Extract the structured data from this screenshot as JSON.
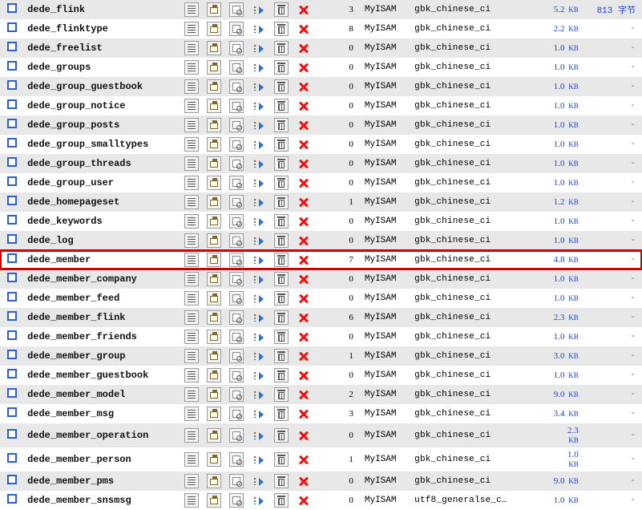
{
  "labels": {
    "size_unit": "KB",
    "overhead_unit": "字节",
    "dash": "-"
  },
  "tables": [
    {
      "name": "dede_flink",
      "rows": 3,
      "engine": "MyISAM",
      "collation": "gbk_chinese_ci",
      "size": "5.2",
      "overhead": "813"
    },
    {
      "name": "dede_flinktype",
      "rows": 8,
      "engine": "MyISAM",
      "collation": "gbk_chinese_ci",
      "size": "2.2",
      "overhead": null
    },
    {
      "name": "dede_freelist",
      "rows": 0,
      "engine": "MyISAM",
      "collation": "gbk_chinese_ci",
      "size": "1.0",
      "overhead": null
    },
    {
      "name": "dede_groups",
      "rows": 0,
      "engine": "MyISAM",
      "collation": "gbk_chinese_ci",
      "size": "1.0",
      "overhead": null
    },
    {
      "name": "dede_group_guestbook",
      "rows": 0,
      "engine": "MyISAM",
      "collation": "gbk_chinese_ci",
      "size": "1.0",
      "overhead": null
    },
    {
      "name": "dede_group_notice",
      "rows": 0,
      "engine": "MyISAM",
      "collation": "gbk_chinese_ci",
      "size": "1.0",
      "overhead": null
    },
    {
      "name": "dede_group_posts",
      "rows": 0,
      "engine": "MyISAM",
      "collation": "gbk_chinese_ci",
      "size": "1.0",
      "overhead": null
    },
    {
      "name": "dede_group_smalltypes",
      "rows": 0,
      "engine": "MyISAM",
      "collation": "gbk_chinese_ci",
      "size": "1.0",
      "overhead": null
    },
    {
      "name": "dede_group_threads",
      "rows": 0,
      "engine": "MyISAM",
      "collation": "gbk_chinese_ci",
      "size": "1.0",
      "overhead": null
    },
    {
      "name": "dede_group_user",
      "rows": 0,
      "engine": "MyISAM",
      "collation": "gbk_chinese_ci",
      "size": "1.0",
      "overhead": null
    },
    {
      "name": "dede_homepageset",
      "rows": 1,
      "engine": "MyISAM",
      "collation": "gbk_chinese_ci",
      "size": "1.2",
      "overhead": null
    },
    {
      "name": "dede_keywords",
      "rows": 0,
      "engine": "MyISAM",
      "collation": "gbk_chinese_ci",
      "size": "1.0",
      "overhead": null
    },
    {
      "name": "dede_log",
      "rows": 0,
      "engine": "MyISAM",
      "collation": "gbk_chinese_ci",
      "size": "1.0",
      "overhead": null
    },
    {
      "name": "dede_member",
      "rows": 7,
      "engine": "MyISAM",
      "collation": "gbk_chinese_ci",
      "size": "4.8",
      "overhead": null,
      "highlight": true
    },
    {
      "name": "dede_member_company",
      "rows": 0,
      "engine": "MyISAM",
      "collation": "gbk_chinese_ci",
      "size": "1.0",
      "overhead": null
    },
    {
      "name": "dede_member_feed",
      "rows": 0,
      "engine": "MyISAM",
      "collation": "gbk_chinese_ci",
      "size": "1.0",
      "overhead": null
    },
    {
      "name": "dede_member_flink",
      "rows": 6,
      "engine": "MyISAM",
      "collation": "gbk_chinese_ci",
      "size": "2.3",
      "overhead": null
    },
    {
      "name": "dede_member_friends",
      "rows": 0,
      "engine": "MyISAM",
      "collation": "gbk_chinese_ci",
      "size": "1.0",
      "overhead": null
    },
    {
      "name": "dede_member_group",
      "rows": 1,
      "engine": "MyISAM",
      "collation": "gbk_chinese_ci",
      "size": "3.0",
      "overhead": null
    },
    {
      "name": "dede_member_guestbook",
      "rows": 0,
      "engine": "MyISAM",
      "collation": "gbk_chinese_ci",
      "size": "1.0",
      "overhead": null
    },
    {
      "name": "dede_member_model",
      "rows": 2,
      "engine": "MyISAM",
      "collation": "gbk_chinese_ci",
      "size": "9.0",
      "overhead": null
    },
    {
      "name": "dede_member_msg",
      "rows": 3,
      "engine": "MyISAM",
      "collation": "gbk_chinese_ci",
      "size": "3.4",
      "overhead": null
    },
    {
      "name": "dede_member_operation",
      "rows": 0,
      "engine": "MyISAM",
      "collation": "gbk_chinese_ci",
      "size": "2.3",
      "overhead": null,
      "size_split": true
    },
    {
      "name": "dede_member_person",
      "rows": 1,
      "engine": "MyISAM",
      "collation": "gbk_chinese_ci",
      "size": "1.0",
      "overhead": null,
      "size_split": true
    },
    {
      "name": "dede_member_pms",
      "rows": 0,
      "engine": "MyISAM",
      "collation": "gbk_chinese_ci",
      "size": "9.0",
      "overhead": null
    },
    {
      "name": "dede_member_snsmsg",
      "rows": 0,
      "engine": "MyISAM",
      "collation": "utf8_generalse_c…",
      "size": "1.0",
      "overhead": null
    }
  ]
}
